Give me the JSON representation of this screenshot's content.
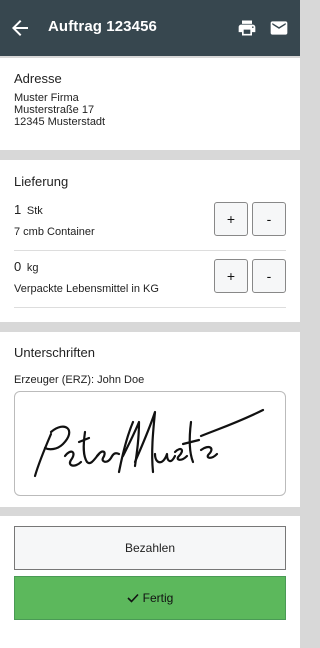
{
  "header": {
    "title": "Auftrag 123456",
    "back_icon": "arrow-left-icon",
    "print_icon": "printer-icon",
    "mail_icon": "envelope-icon",
    "bg_color": "#37474f"
  },
  "address": {
    "title": "Adresse",
    "lines": [
      "Muster Firma",
      "Musterstraße 17",
      "12345 Musterstadt"
    ]
  },
  "delivery": {
    "title": "Lieferung",
    "items": [
      {
        "quantity": "1",
        "unit": "Stk",
        "description": "7 cmb Container",
        "plus_label": "+",
        "minus_label": "-"
      },
      {
        "quantity": "0",
        "unit": "kg",
        "description": "Verpackte Lebensmittel in KG",
        "plus_label": "+",
        "minus_label": "-"
      }
    ]
  },
  "signatures": {
    "title": "Unterschriften",
    "producer": "Erzeuger (ERZ): John Doe",
    "signature_text": "Peter Muster"
  },
  "actions": {
    "pay_label": "Bezahlen",
    "done_label": "Fertig",
    "done_icon": "check-icon",
    "done_color": "#5cb85c"
  }
}
